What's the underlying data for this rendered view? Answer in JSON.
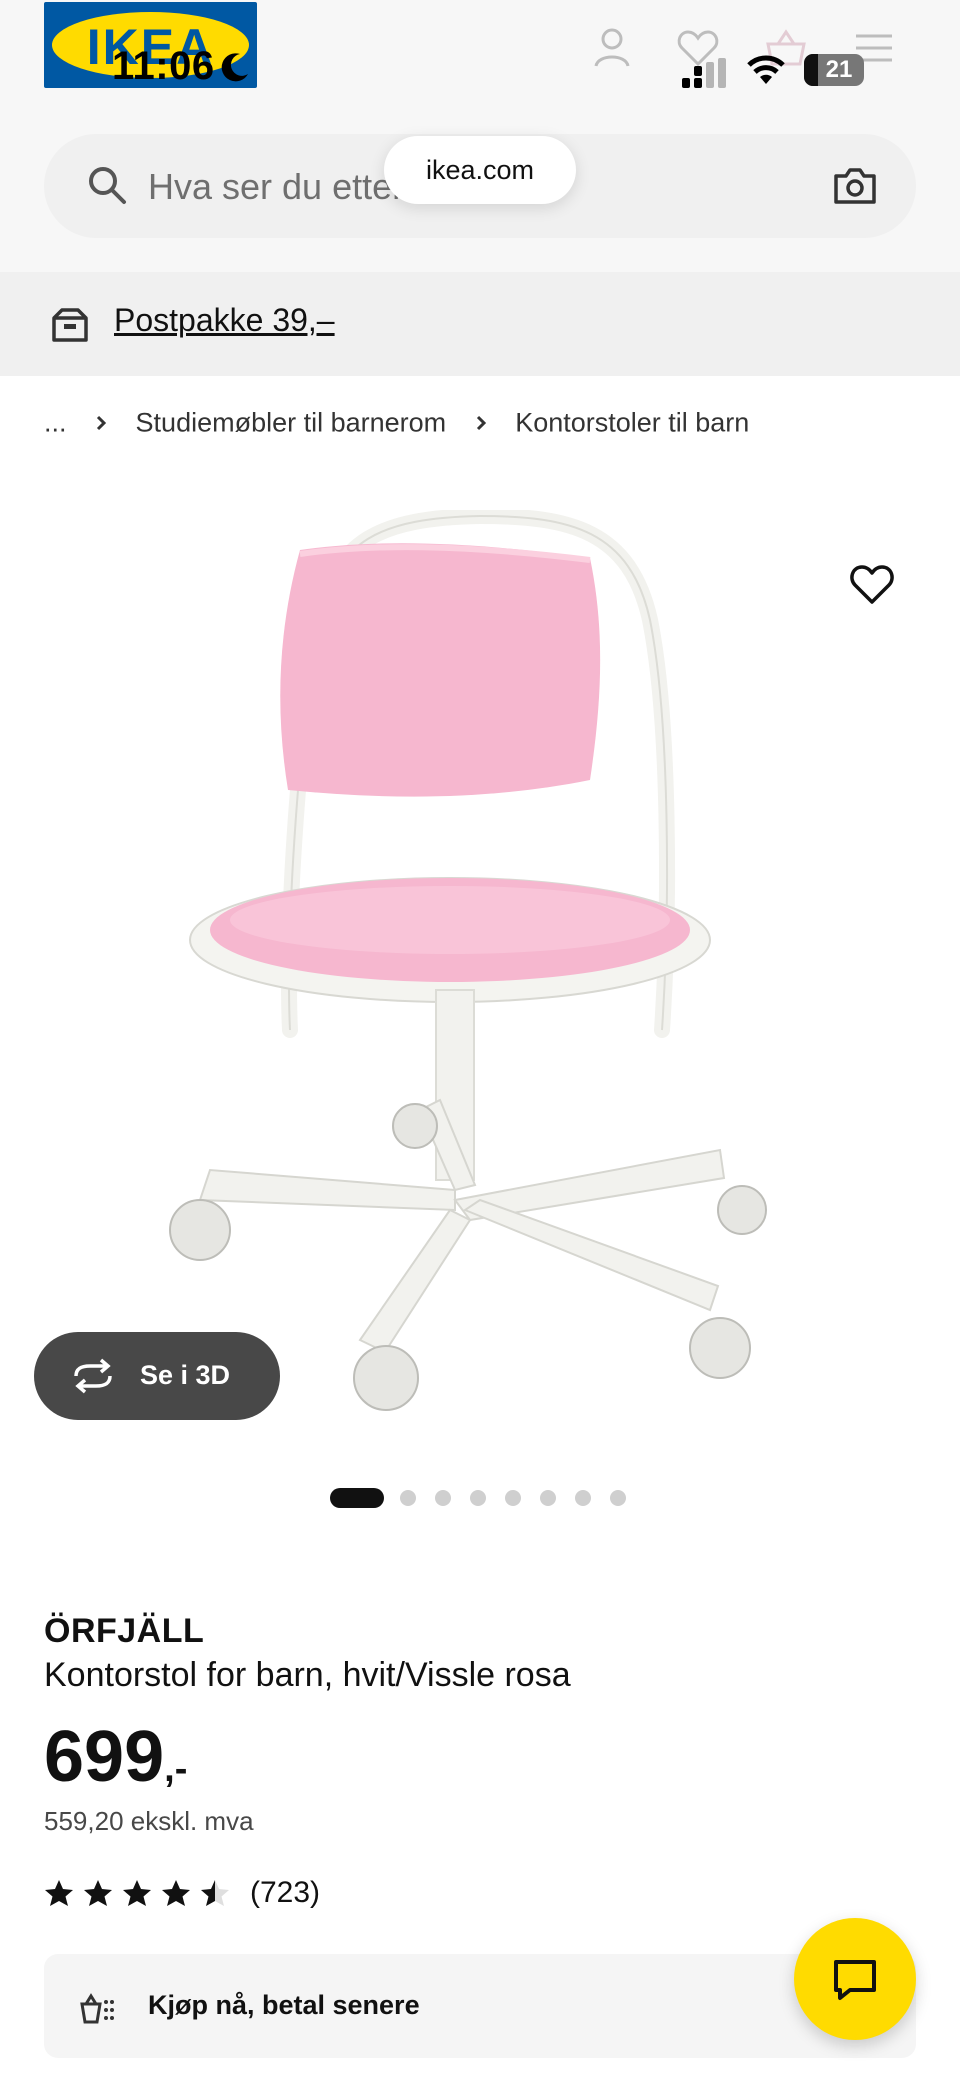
{
  "status_bar": {
    "time": "11:06",
    "battery": "21",
    "icons": [
      "moon-icon",
      "signal-icon",
      "wifi-icon",
      "battery-icon"
    ]
  },
  "header": {
    "logo_text": "IKEA",
    "icons": [
      "user-icon",
      "heart-icon",
      "basket-icon",
      "menu-icon"
    ]
  },
  "search": {
    "placeholder": "Hva ser du etter?",
    "url": "ikea.com"
  },
  "banner": {
    "text": "Postpakke 39,–"
  },
  "breadcrumb": {
    "ellipsis": "...",
    "items": [
      "Studiemøbler til barnerom",
      "Kontorstoler til barn"
    ]
  },
  "gallery": {
    "button_3d": "Se i 3D",
    "total_images": 8,
    "active_index": 0
  },
  "product": {
    "name": "ÖRFJÄLL",
    "description": "Kontorstol for barn, hvit/Vissle rosa",
    "price": "699",
    "price_suffix": ",-",
    "price_ex_vat": "559,20 ekskl. mva",
    "rating": 4.5,
    "rating_max": 5,
    "rating_count": "(723)"
  },
  "bnpl": {
    "label": "Kjøp nå, betal senere"
  },
  "colors": {
    "ikea_blue": "#0058a3",
    "ikea_yellow": "#ffdb00",
    "seat_pink": "#f5b3cd",
    "button_dark": "#484848"
  }
}
